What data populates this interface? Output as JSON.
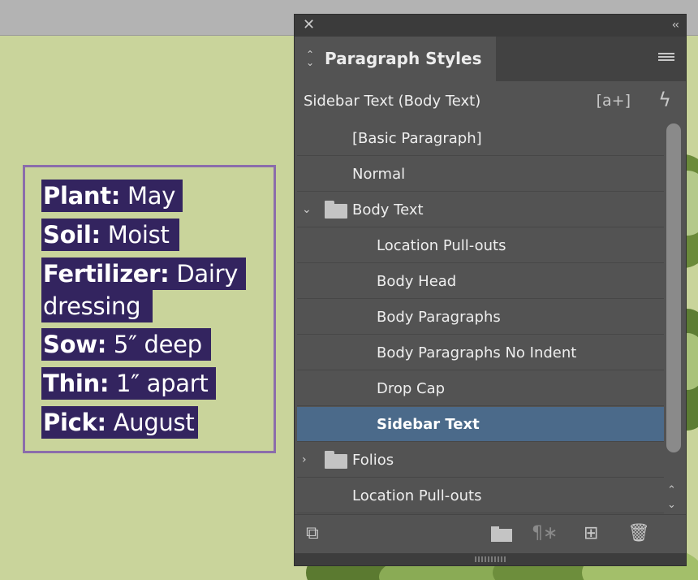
{
  "sidebar_text": {
    "lines": [
      {
        "bold": "Plant:",
        "text": " May"
      },
      {
        "bold": "Soil:",
        "text": " Moist"
      },
      {
        "bold": "Fertilizer:",
        "text": " Dairy"
      },
      {
        "bold": "",
        "text": "dressing"
      },
      {
        "bold": "Sow:",
        "text": " 5″ deep"
      },
      {
        "bold": "Thin:",
        "text": " 1″ apart"
      },
      {
        "bold": "Pick:",
        "text": " August"
      }
    ]
  },
  "panel": {
    "close_glyph": "✕",
    "collapse_glyph": "‹‹",
    "tab_title": "Paragraph Styles",
    "current_style": "Sidebar Text (Body Text)",
    "new_style_icon": "[a+]",
    "quick_apply_icon": "ϟ",
    "styles": [
      {
        "label": "[Basic Paragraph]",
        "level": 1,
        "type": "style",
        "selected": false
      },
      {
        "label": "Normal",
        "level": 1,
        "type": "style",
        "selected": false
      },
      {
        "label": "Body Text",
        "level": 1,
        "type": "group",
        "expanded": true,
        "selected": false
      },
      {
        "label": "Location Pull-outs",
        "level": 2,
        "type": "style",
        "selected": false
      },
      {
        "label": "Body Head",
        "level": 2,
        "type": "style",
        "selected": false
      },
      {
        "label": "Body Paragraphs",
        "level": 2,
        "type": "style",
        "selected": false
      },
      {
        "label": "Body Paragraphs No Indent",
        "level": 2,
        "type": "style",
        "selected": false
      },
      {
        "label": "Drop Cap",
        "level": 2,
        "type": "style",
        "selected": false
      },
      {
        "label": "Sidebar Text",
        "level": 2,
        "type": "style",
        "selected": true
      },
      {
        "label": "Folios",
        "level": 1,
        "type": "group",
        "expanded": false,
        "selected": false
      },
      {
        "label": "Location Pull-outs",
        "level": 1,
        "type": "style",
        "selected": false
      }
    ],
    "bottom_icons": {
      "load": "⧉",
      "clear_overrides": "¶∗",
      "new_style": "⊞",
      "delete": "🗑"
    }
  },
  "colors": {
    "page_background": "#c9d49b",
    "text_highlight": "#33245f",
    "frame_border": "#8b6dab",
    "panel_bg": "#535353",
    "selected_row": "#4b6a8a"
  }
}
